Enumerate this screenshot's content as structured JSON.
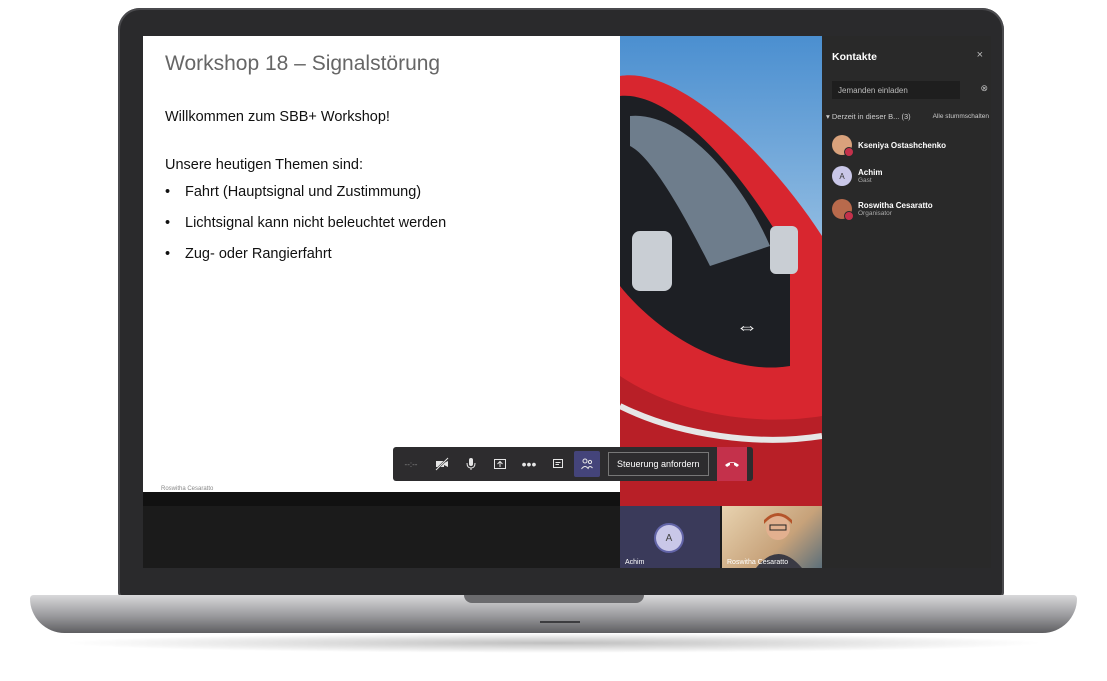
{
  "slide": {
    "title": "Workshop 18 – Signalstörung",
    "welcome": "Willkommen zum SBB+ Workshop!",
    "topics_heading": "Unsere heutigen Themen sind:",
    "bullets": [
      "Fahrt (Hauptsignal und Zustimmung)",
      "Lichtsignal kann nicht beleuchtet werden",
      "Zug- oder Rangierfahrt"
    ],
    "presenter_tag": "Roswitha Cesaratto"
  },
  "controls": {
    "timer": "--:--",
    "camera_icon": "camera-off-icon",
    "mic_icon": "microphone-icon",
    "share_icon": "share-screen-icon",
    "more_icon": "more-options-icon",
    "chat_icon": "chat-icon",
    "participants_icon": "participants-icon",
    "request_control_label": "Steuerung anfordern",
    "hangup_icon": "hang-up-icon"
  },
  "thumbnails": [
    {
      "name": "Achim",
      "initial": "A"
    },
    {
      "name": "Roswitha Cesaratto"
    }
  ],
  "panel": {
    "title": "Kontakte",
    "close": "×",
    "invite_placeholder": "Jemanden einladen",
    "section": "Derzeit in dieser B... (3)",
    "mute_all": "Alle stummschalten",
    "members": [
      {
        "name": "Kseniya Ostashchenko",
        "role": ""
      },
      {
        "name": "Achim",
        "role": "Gast",
        "initial": "A"
      },
      {
        "name": "Roswitha Cesaratto",
        "role": "Organisator"
      }
    ]
  },
  "colors": {
    "accent": "#6264a7",
    "hangup": "#c4314b",
    "panel_bg": "#292929"
  }
}
